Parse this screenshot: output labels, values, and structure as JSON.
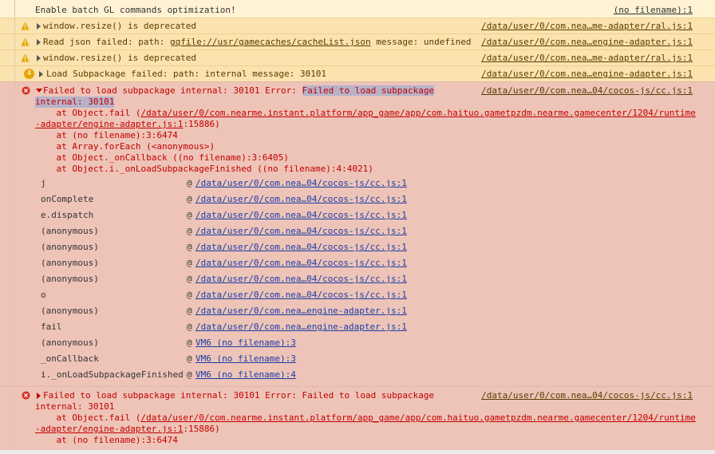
{
  "messages": {
    "info1": {
      "text": "Enable batch GL commands optimization!",
      "source": "(no filename):1"
    },
    "warn1": {
      "text": "window.resize() is deprecated",
      "source": "/data/user/0/com.nea…me-adapter/ral.js:1"
    },
    "warn2": {
      "text_prefix": "Read json failed: path: ",
      "path": "gqfile://usr/gamecaches/cacheList.json",
      "text_suffix": " message: undefined",
      "source": "/data/user/0/com.nea…engine-adapter.js:1"
    },
    "warn3": {
      "text": "window.resize() is deprecated",
      "source": "/data/user/0/com.nea…me-adapter/ral.js:1"
    },
    "warn4": {
      "text": "Load Subpackage failed: path: internal message: 30101",
      "source": "/data/user/0/com.nea…engine-adapter.js:1",
      "badge": "4"
    },
    "error1": {
      "head_plain": "Failed to load subpackage internal: 30101 Error: ",
      "head_highlight": "Failed to load subpackage",
      "head_cont": "internal: 30101",
      "source": "/data/user/0/com.nea…04/cocos-js/cc.js:1",
      "at_fail_prefix": "    at Object.fail (",
      "at_fail_link": "/data/user/0/com.nearme.instant.platform/app_game/app/com.haituo.gametpzdm.nearme.gamecenter/1204/runtime",
      "at_fail_link2": "-adapter/engine-adapter.js:1",
      "at_fail_suffix": ":15886)",
      "stack_lines": [
        "    at (no filename):3:6474",
        "    at Array.forEach (<anonymous>)",
        "    at Object._onCallback ((no filename):3:6405)",
        "    at Object.i._onLoadSubpackageFinished ((no filename):4:4021)"
      ],
      "frames": [
        {
          "fn": "j",
          "loc": "/data/user/0/com.nea…04/cocos-js/cc.js:1"
        },
        {
          "fn": "onComplete",
          "loc": "/data/user/0/com.nea…04/cocos-js/cc.js:1"
        },
        {
          "fn": "e.dispatch",
          "loc": "/data/user/0/com.nea…04/cocos-js/cc.js:1"
        },
        {
          "fn": "(anonymous)",
          "loc": "/data/user/0/com.nea…04/cocos-js/cc.js:1"
        },
        {
          "fn": "(anonymous)",
          "loc": "/data/user/0/com.nea…04/cocos-js/cc.js:1"
        },
        {
          "fn": "(anonymous)",
          "loc": "/data/user/0/com.nea…04/cocos-js/cc.js:1"
        },
        {
          "fn": "(anonymous)",
          "loc": "/data/user/0/com.nea…04/cocos-js/cc.js:1"
        },
        {
          "fn": "o",
          "loc": "/data/user/0/com.nea…04/cocos-js/cc.js:1"
        },
        {
          "fn": "(anonymous)",
          "loc": "/data/user/0/com.nea…engine-adapter.js:1"
        },
        {
          "fn": "fail",
          "loc": "/data/user/0/com.nea…engine-adapter.js:1"
        },
        {
          "fn": "(anonymous)",
          "loc": "VM6 (no filename):3"
        },
        {
          "fn": "_onCallback",
          "loc": "VM6 (no filename):3"
        },
        {
          "fn": "i._onLoadSubpackageFinished",
          "loc": "VM6 (no filename):4"
        }
      ],
      "at_sign": "@"
    },
    "error2": {
      "head": "Failed to load subpackage internal: 30101 Error: Failed to load subpackage",
      "head_cont": "internal: 30101",
      "source": "/data/user/0/com.nea…04/cocos-js/cc.js:1",
      "at_fail_prefix": "    at Object.fail (",
      "at_fail_link": "/data/user/0/com.nearme.instant.platform/app_game/app/com.haituo.gametpzdm.nearme.gamecenter/1204/runtime",
      "at_fail_link2": "-adapter/engine-adapter.js:1",
      "at_fail_suffix": ":15886)",
      "stack_line": "    at (no filename):3:6474"
    }
  },
  "colors": {
    "info_bg": "#fff3d4",
    "warn_bg": "#fbe3b0",
    "error_bg": "#eec4b8",
    "error_text": "#c40000",
    "link": "#1a3ea8"
  }
}
